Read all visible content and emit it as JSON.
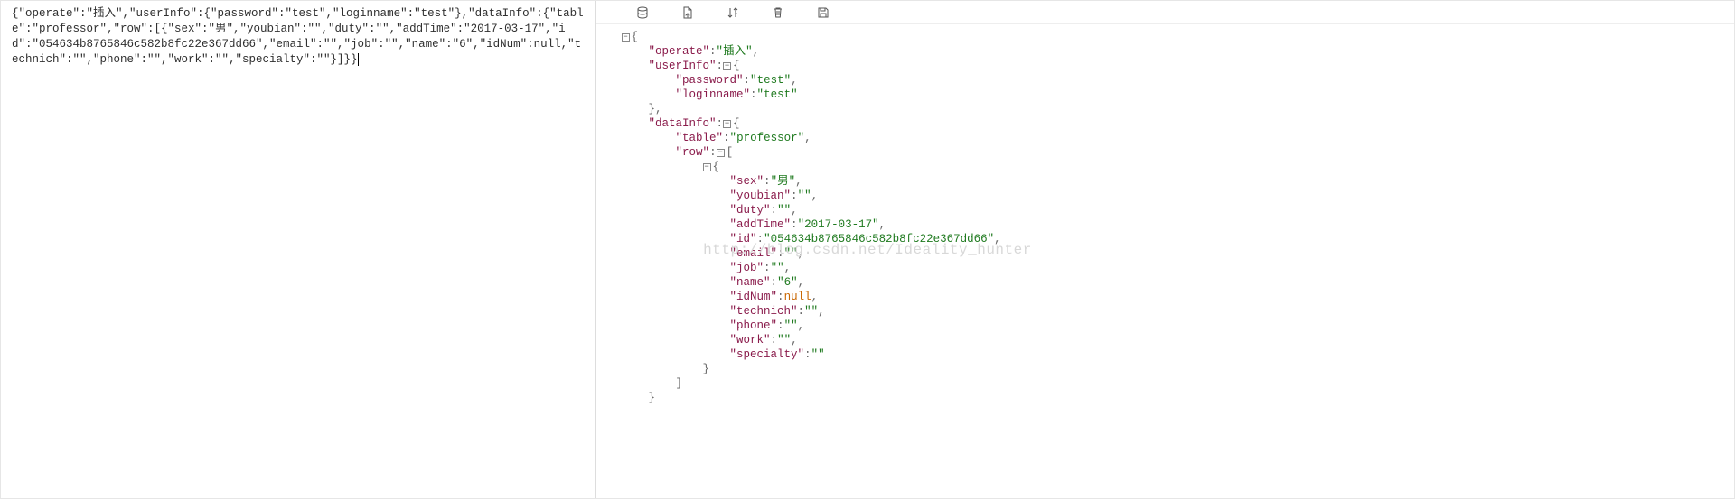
{
  "watermark": "http://blog.csdn.net/Ideality_hunter",
  "rawJson": "{\"operate\":\"插入\",\"userInfo\":{\"password\":\"test\",\"loginname\":\"test\"},\"dataInfo\":{\"table\":\"professor\",\"row\":[{\"sex\":\"男\",\"youbian\":\"\",\"duty\":\"\",\"addTime\":\"2017-03-17\",\"id\":\"054634b8765846c582b8fc22e367dd66\",\"email\":\"\",\"job\":\"\",\"name\":\"6\",\"idNum\":null,\"technich\":\"\",\"phone\":\"\",\"work\":\"\",\"specialty\":\"\"}]}}",
  "pretty": {
    "operate": "插入",
    "userInfo": {
      "password": "test",
      "loginname": "test"
    },
    "dataInfo": {
      "table": "professor",
      "row_label": "row",
      "row0": {
        "sex": "男",
        "youbian": "",
        "duty": "",
        "addTime": "2017-03-17",
        "id": "054634b8765846c582b8fc22e367dd66",
        "email": "",
        "job": "",
        "name": "6",
        "idNum": "null",
        "technich": "",
        "phone": "",
        "work": "",
        "specialty": ""
      }
    }
  },
  "toolbar": {
    "compact": "compact",
    "export": "export",
    "sort": "sort",
    "delete": "delete",
    "save": "save"
  }
}
